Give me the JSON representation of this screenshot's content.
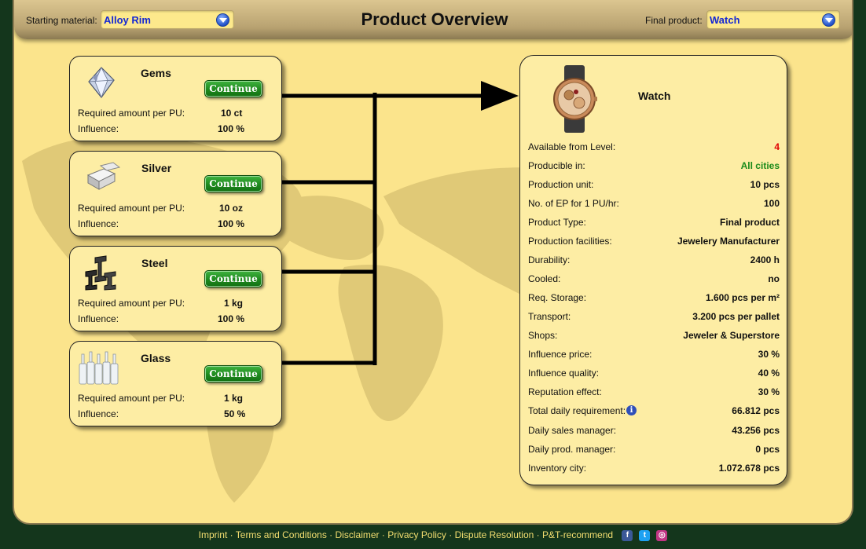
{
  "header": {
    "starting_label": "Starting material:",
    "starting_value": "Alloy Rim",
    "title": "Product Overview",
    "final_label": "Final product:",
    "final_value": "Watch"
  },
  "materials": [
    {
      "name": "Gems",
      "icon": "gems-icon",
      "button": "Continue",
      "req_label": "Required amount per PU:",
      "req_value": "10 ct",
      "inf_label": "Influence:",
      "inf_value": "100 %"
    },
    {
      "name": "Silver",
      "icon": "silver-icon",
      "button": "Continue",
      "req_label": "Required amount per PU:",
      "req_value": "10 oz",
      "inf_label": "Influence:",
      "inf_value": "100 %"
    },
    {
      "name": "Steel",
      "icon": "steel-icon",
      "button": "Continue",
      "req_label": "Required amount per PU:",
      "req_value": "1 kg",
      "inf_label": "Influence:",
      "inf_value": "100 %"
    },
    {
      "name": "Glass",
      "icon": "glass-bottles-icon",
      "button": "Continue",
      "req_label": "Required amount per PU:",
      "req_value": "1 kg",
      "inf_label": "Influence:",
      "inf_value": "50 %"
    }
  ],
  "product": {
    "name": "Watch",
    "icon": "watch-icon",
    "details": [
      {
        "label": "Available from Level:",
        "value": "4",
        "color": "#e00000"
      },
      {
        "label": "Producible in:",
        "value": "All cities",
        "color": "#1a8a1a"
      },
      {
        "label": "Production unit:",
        "value": "10 pcs"
      },
      {
        "label": "No. of EP for 1 PU/hr:",
        "value": "100"
      },
      {
        "label": "Product Type:",
        "value": "Final product"
      },
      {
        "label": "Production facilities:",
        "value": "Jewelery Manufacturer"
      },
      {
        "label": "Durability:",
        "value": "2400 h"
      },
      {
        "label": "Cooled:",
        "value": "no"
      },
      {
        "label": "Req. Storage:",
        "value": "1.600 pcs per m²"
      },
      {
        "label": "Transport:",
        "value": "3.200 pcs per pallet"
      },
      {
        "label": "Shops:",
        "value": "Jeweler & Superstore"
      },
      {
        "label": "Influence price:",
        "value": "30 %"
      },
      {
        "label": "Influence quality:",
        "value": "40 %"
      },
      {
        "label": "Reputation effect:",
        "value": "30 %"
      },
      {
        "label": "Total daily requirement:",
        "value": "66.812 pcs",
        "info": "i"
      },
      {
        "label": "Daily sales manager:",
        "value": "43.256 pcs"
      },
      {
        "label": "Daily prod. manager:",
        "value": "0 pcs"
      },
      {
        "label": "Inventory city:",
        "value": "1.072.678 pcs"
      }
    ]
  },
  "footer": {
    "links": [
      "Imprint",
      "Terms and Conditions",
      "Disclaimer",
      "Privacy Policy",
      "Dispute Resolution",
      "P&T-recommend"
    ],
    "separator": "·",
    "social": [
      {
        "icon": "facebook-icon",
        "glyph": "f",
        "color": "#3b5998"
      },
      {
        "icon": "twitter-icon",
        "glyph": "t",
        "color": "#1da1f2"
      },
      {
        "icon": "instagram-icon",
        "glyph": "◎",
        "color": "#c13584"
      }
    ]
  }
}
